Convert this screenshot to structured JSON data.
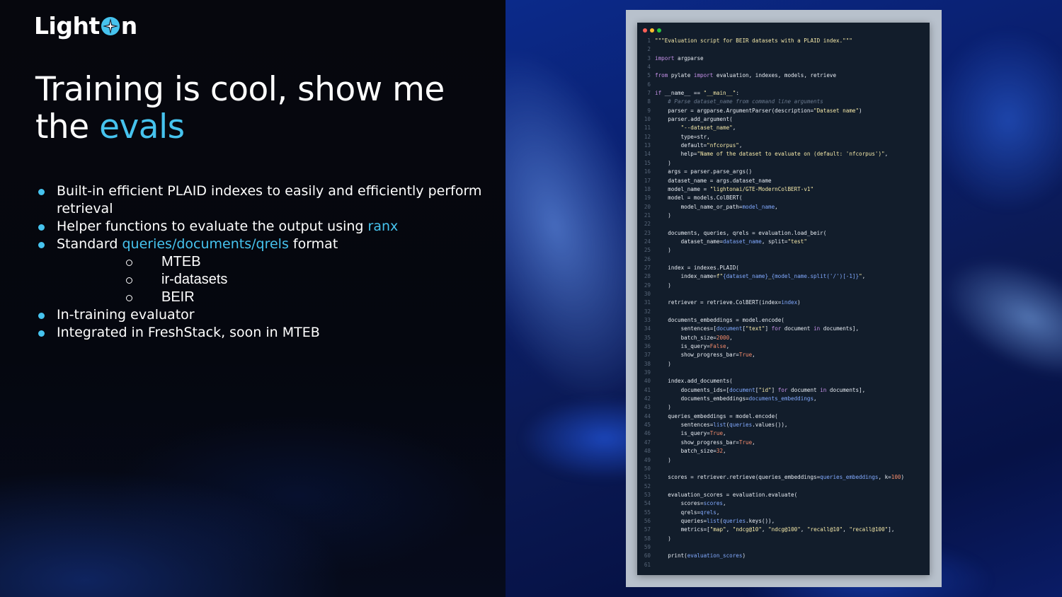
{
  "brand": {
    "logo_left": "Light",
    "logo_right": "n"
  },
  "slide": {
    "title_main": "Training is cool, show me the ",
    "title_accent": "evals",
    "bullets": [
      {
        "text": "Built-in efficient PLAID indexes to easily and efficiently perform retrieval"
      },
      {
        "text": "Helper functions to evaluate the output using ",
        "link": "ranx"
      },
      {
        "text": "Standard ",
        "link": "queries/documents/qrels",
        "after": " format",
        "sub": [
          "MTEB",
          "ir-datasets",
          "BEIR"
        ]
      },
      {
        "text": "In-training evaluator"
      },
      {
        "text": "Integrated in FreshStack, soon in MTEB"
      }
    ]
  },
  "colors": {
    "accent": "#46c3ee",
    "background": "#04060d",
    "code_bg": "#121d2b",
    "code_frame": "#b8c1cc",
    "window_dots": [
      "#ff5f57",
      "#febc2e",
      "#28c840"
    ],
    "syntax": {
      "default": "#e7ecf3",
      "keyword": "#c792ea",
      "string": "#f5e9a9",
      "comment": "#6b7a8f",
      "number": "#f78c6c",
      "param": "#82aaff",
      "linenum": "#566477"
    }
  },
  "code": {
    "lines": [
      [
        [
          "s",
          "\"\"\"Evaluation script for BEIR datasets with a PLAID index.\"\"\""
        ]
      ],
      [],
      [
        [
          "k",
          "import"
        ],
        [
          "t",
          " argparse"
        ]
      ],
      [],
      [
        [
          "k",
          "from"
        ],
        [
          "t",
          " pylate "
        ],
        [
          "k",
          "import"
        ],
        [
          "t",
          " evaluation, indexes, models, retrieve"
        ]
      ],
      [],
      [
        [
          "k",
          "if"
        ],
        [
          "t",
          " __name__ == "
        ],
        [
          "s",
          "\"__main__\""
        ],
        [
          "t",
          ":"
        ]
      ],
      [
        [
          "c",
          "    # Parse dataset_name from command line arguments"
        ]
      ],
      [
        [
          "t",
          "    parser = argparse.ArgumentParser(description="
        ],
        [
          "s",
          "\"Dataset name\""
        ],
        [
          "t",
          ")"
        ]
      ],
      [
        [
          "t",
          "    parser.add_argument("
        ]
      ],
      [
        [
          "s",
          "        \"--dataset_name\""
        ],
        [
          "t",
          ","
        ]
      ],
      [
        [
          "t",
          "        type=str,"
        ]
      ],
      [
        [
          "t",
          "        default="
        ],
        [
          "s",
          "\"nfcorpus\""
        ],
        [
          "t",
          ","
        ]
      ],
      [
        [
          "t",
          "        help="
        ],
        [
          "s",
          "\"Name of the dataset to evaluate on (default: 'nfcorpus')\""
        ],
        [
          "t",
          ","
        ]
      ],
      [
        [
          "t",
          "    )"
        ]
      ],
      [
        [
          "t",
          "    args = parser.parse_args()"
        ]
      ],
      [
        [
          "t",
          "    dataset_name = args.dataset_name"
        ]
      ],
      [
        [
          "t",
          "    model_name = "
        ],
        [
          "s",
          "\"lightonai/GTE-ModernColBERT-v1\""
        ]
      ],
      [
        [
          "t",
          "    model = models.ColBERT("
        ]
      ],
      [
        [
          "t",
          "        model_name_or_path="
        ],
        [
          "p",
          "model_name"
        ],
        [
          "t",
          ","
        ]
      ],
      [
        [
          "t",
          "    )"
        ]
      ],
      [],
      [
        [
          "t",
          "    documents, queries, qrels = evaluation.load_beir("
        ]
      ],
      [
        [
          "t",
          "        dataset_name="
        ],
        [
          "p",
          "dataset_name"
        ],
        [
          "t",
          ", split="
        ],
        [
          "s",
          "\"test\""
        ]
      ],
      [
        [
          "t",
          "    )"
        ]
      ],
      [],
      [
        [
          "t",
          "    index = indexes.PLAID("
        ]
      ],
      [
        [
          "t",
          "        index_name="
        ],
        [
          "s",
          "f\""
        ],
        [
          "p",
          "{dataset_name}"
        ],
        [
          "s",
          "_"
        ],
        [
          "p",
          "{model_name.split('/')[-1]}"
        ],
        [
          "s",
          "\""
        ],
        [
          "t",
          ","
        ]
      ],
      [
        [
          "t",
          "    )"
        ]
      ],
      [],
      [
        [
          "t",
          "    retriever = retrieve.ColBERT(index="
        ],
        [
          "p",
          "index"
        ],
        [
          "t",
          ")"
        ]
      ],
      [],
      [
        [
          "t",
          "    documents_embeddings = model.encode("
        ]
      ],
      [
        [
          "t",
          "        sentences=["
        ],
        [
          "p",
          "document"
        ],
        [
          "t",
          "["
        ],
        [
          "s",
          "\"text\""
        ],
        [
          "t",
          "] "
        ],
        [
          "k",
          "for"
        ],
        [
          "t",
          " document "
        ],
        [
          "k",
          "in"
        ],
        [
          "t",
          " documents],"
        ]
      ],
      [
        [
          "t",
          "        batch_size="
        ],
        [
          "n",
          "2000"
        ],
        [
          "t",
          ","
        ]
      ],
      [
        [
          "t",
          "        is_query="
        ],
        [
          "n",
          "False"
        ],
        [
          "t",
          ","
        ]
      ],
      [
        [
          "t",
          "        show_progress_bar="
        ],
        [
          "n",
          "True"
        ],
        [
          "t",
          ","
        ]
      ],
      [
        [
          "t",
          "    )"
        ]
      ],
      [],
      [
        [
          "t",
          "    index.add_documents("
        ]
      ],
      [
        [
          "t",
          "        documents_ids=["
        ],
        [
          "p",
          "document"
        ],
        [
          "t",
          "["
        ],
        [
          "s",
          "\"id\""
        ],
        [
          "t",
          "] "
        ],
        [
          "k",
          "for"
        ],
        [
          "t",
          " document "
        ],
        [
          "k",
          "in"
        ],
        [
          "t",
          " documents],"
        ]
      ],
      [
        [
          "t",
          "        documents_embeddings="
        ],
        [
          "p",
          "documents_embeddings"
        ],
        [
          "t",
          ","
        ]
      ],
      [
        [
          "t",
          "    )"
        ]
      ],
      [
        [
          "t",
          "    queries_embeddings = model.encode("
        ]
      ],
      [
        [
          "t",
          "        sentences="
        ],
        [
          "p",
          "list"
        ],
        [
          "t",
          "("
        ],
        [
          "p",
          "queries"
        ],
        [
          "t",
          ".values()),"
        ]
      ],
      [
        [
          "t",
          "        is_query="
        ],
        [
          "n",
          "True"
        ],
        [
          "t",
          ","
        ]
      ],
      [
        [
          "t",
          "        show_progress_bar="
        ],
        [
          "n",
          "True"
        ],
        [
          "t",
          ","
        ]
      ],
      [
        [
          "t",
          "        batch_size="
        ],
        [
          "n",
          "32"
        ],
        [
          "t",
          ","
        ]
      ],
      [
        [
          "t",
          "    )"
        ]
      ],
      [],
      [
        [
          "t",
          "    scores = retriever.retrieve(queries_embeddings="
        ],
        [
          "p",
          "queries_embeddings"
        ],
        [
          "t",
          ", k="
        ],
        [
          "n",
          "100"
        ],
        [
          "t",
          ")"
        ]
      ],
      [],
      [
        [
          "t",
          "    evaluation_scores = evaluation.evaluate("
        ]
      ],
      [
        [
          "t",
          "        scores="
        ],
        [
          "p",
          "scores"
        ],
        [
          "t",
          ","
        ]
      ],
      [
        [
          "t",
          "        qrels="
        ],
        [
          "p",
          "qrels"
        ],
        [
          "t",
          ","
        ]
      ],
      [
        [
          "t",
          "        queries="
        ],
        [
          "p",
          "list"
        ],
        [
          "t",
          "("
        ],
        [
          "p",
          "queries"
        ],
        [
          "t",
          ".keys()),"
        ]
      ],
      [
        [
          "t",
          "        metrics=["
        ],
        [
          "s",
          "\"map\""
        ],
        [
          "t",
          ", "
        ],
        [
          "s",
          "\"ndcg@10\""
        ],
        [
          "t",
          ", "
        ],
        [
          "s",
          "\"ndcg@100\""
        ],
        [
          "t",
          ", "
        ],
        [
          "s",
          "\"recall@10\""
        ],
        [
          "t",
          ", "
        ],
        [
          "s",
          "\"recall@100\""
        ],
        [
          "t",
          "],"
        ]
      ],
      [
        [
          "t",
          "    )"
        ]
      ],
      [],
      [
        [
          "t",
          "    print("
        ],
        [
          "p",
          "evaluation_scores"
        ],
        [
          "t",
          ")"
        ]
      ],
      []
    ]
  }
}
